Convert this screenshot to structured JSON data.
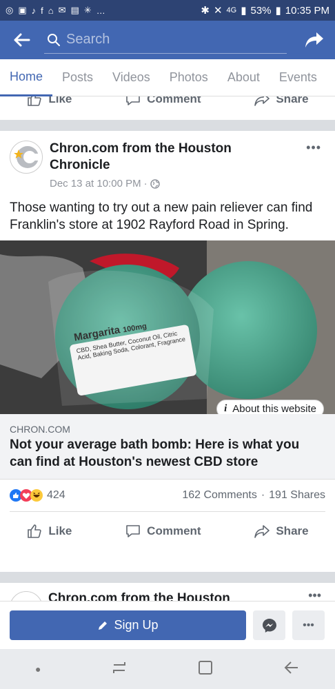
{
  "status_bar": {
    "battery": "53%",
    "time": "10:35 PM",
    "network": "4G"
  },
  "app_bar": {
    "search_placeholder": "Search"
  },
  "tabs": [
    {
      "label": "Home",
      "active": true
    },
    {
      "label": "Posts"
    },
    {
      "label": "Videos"
    },
    {
      "label": "Photos"
    },
    {
      "label": "About"
    },
    {
      "label": "Events"
    }
  ],
  "actions": {
    "like": "Like",
    "comment": "Comment",
    "share": "Share"
  },
  "post": {
    "author": "Chron.com from the Houston Chronicle",
    "timestamp": "Dec 13 at 10:00 PM",
    "text": "Those wanting to try out a new pain reliever can find Franklin's store at 1902 Rayford Road in Spring.",
    "image_label_title": "Margarita",
    "image_label_size": "100mg",
    "image_label_line1": "CBD, Shea Butter, Coconut Oil, Citric",
    "image_label_line2": "Acid, Baking Soda, Colorant, Fragrance",
    "about_website": "About this website",
    "link_domain": "CHRON.COM",
    "link_title": "Not your average bath bomb: Here is what you can find at Houston's newest CBD store",
    "reaction_count": "424",
    "comments": "162 Comments",
    "shares": "191 Shares"
  },
  "next_post": {
    "author": "Chron.com from the Houston"
  },
  "bottom_cta": {
    "signup": "Sign Up"
  },
  "colors": {
    "brand": "#4267b2",
    "status": "#2d4373"
  }
}
